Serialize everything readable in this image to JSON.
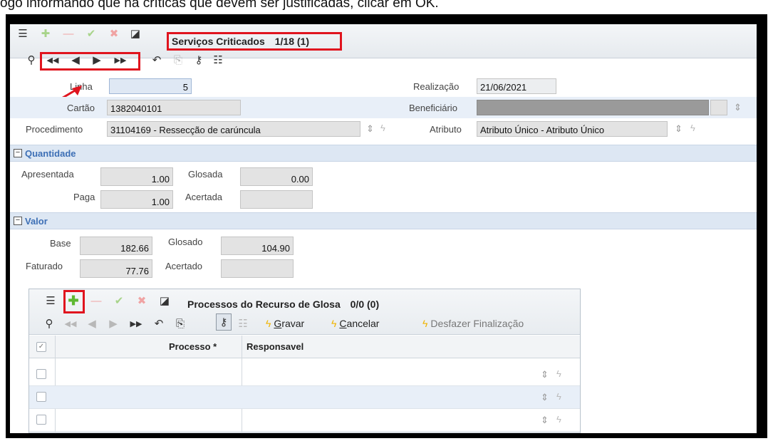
{
  "caption": "ogo informando que há críticas que devem ser justificadas, clicar em OK.",
  "window": {
    "title": "Serviços Criticados",
    "counter": "1/18 (1)"
  },
  "form": {
    "linha": {
      "label": "Linha",
      "value": "5"
    },
    "realizacao": {
      "label": "Realização",
      "value": "21/06/2021"
    },
    "cartao": {
      "label": "Cartão",
      "value": "1382040101"
    },
    "beneficiario": {
      "label": "Beneficiário",
      "value": ""
    },
    "procedimento": {
      "label": "Procedimento",
      "value": "31104169 - Ressecção de carúncula"
    },
    "atributo": {
      "label": "Atributo",
      "value": "Atributo Único - Atributo Único"
    }
  },
  "quantidade": {
    "title": "Quantidade",
    "apresentada": {
      "label": "Apresentada",
      "value": "1.00"
    },
    "glosada": {
      "label": "Glosada",
      "value": "0.00"
    },
    "paga": {
      "label": "Paga",
      "value": "1.00"
    },
    "acertada": {
      "label": "Acertada",
      "value": ""
    }
  },
  "valor": {
    "title": "Valor",
    "base": {
      "label": "Base",
      "value": "182.66"
    },
    "glosado": {
      "label": "Glosado",
      "value": "104.90"
    },
    "faturado": {
      "label": "Faturado",
      "value": "77.76"
    },
    "acertado": {
      "label": "Acertado",
      "value": ""
    }
  },
  "subpanel": {
    "title": "Processos do Recurso de Glosa",
    "counter": "0/0 (0)",
    "actions": {
      "gravar": {
        "mnemonic": "G",
        "rest": "ravar"
      },
      "cancelar": {
        "mnemonic": "C",
        "rest": "ancelar"
      },
      "desfazer": "Desfazer Finalização"
    },
    "columns": {
      "processo": "Processo *",
      "responsavel": "Responsavel"
    },
    "rows": [
      "",
      "",
      ""
    ]
  },
  "colors": {
    "highlight": "#e0141e",
    "section_title": "#3d6fb5",
    "bolt": "#f0b400",
    "add": "#5fb832"
  },
  "icons": [
    "list-icon",
    "add-icon",
    "remove-icon",
    "confirm-icon",
    "cancel-icon",
    "form-view-icon",
    "search-icon",
    "first-icon",
    "previous-icon",
    "next-icon",
    "last-icon",
    "undo-icon",
    "export-icon",
    "key-icon",
    "details-list-icon",
    "bolt-icon",
    "spinner-icon",
    "checkbox-icon"
  ]
}
